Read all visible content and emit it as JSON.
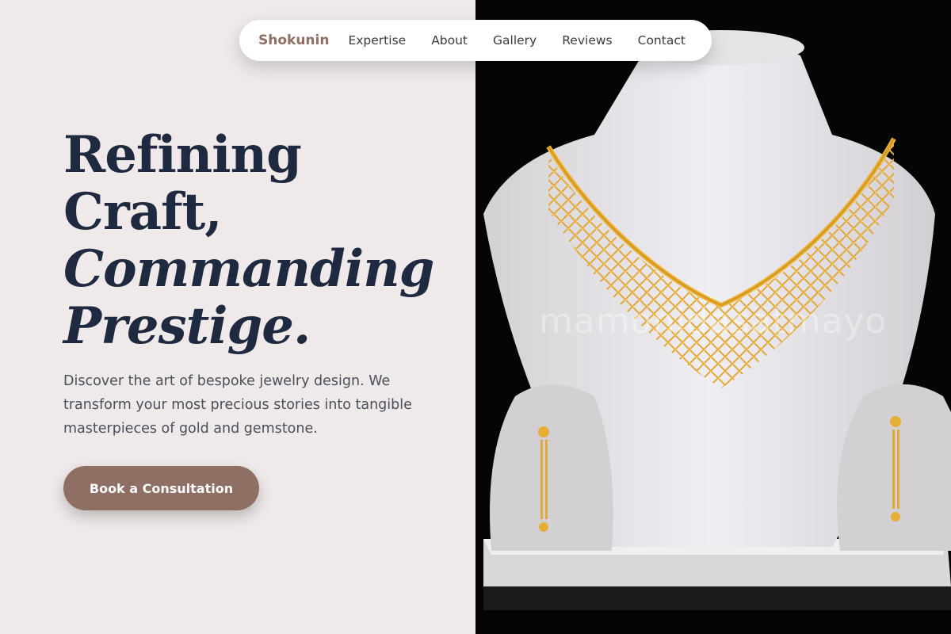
{
  "nav": {
    "brand": "Shokunin",
    "links": [
      "Expertise",
      "About",
      "Gallery",
      "Reviews",
      "Contact"
    ]
  },
  "hero": {
    "title_line1": "Refining",
    "title_line2": "Craft,",
    "title_line3": "Commanding",
    "title_line4": "Prestige.",
    "description": "Discover the art of bespoke jewelry design. We transform your most precious stories into tangible masterpieces of gold and gemstone.",
    "cta_label": "Book a Consultation"
  },
  "photo": {
    "watermark": "mamonidasatmayo"
  },
  "colors": {
    "accent": "#8f6e63",
    "heading": "#1f2940",
    "left_bg": "#efeae9",
    "gold": "#e2a93a"
  }
}
